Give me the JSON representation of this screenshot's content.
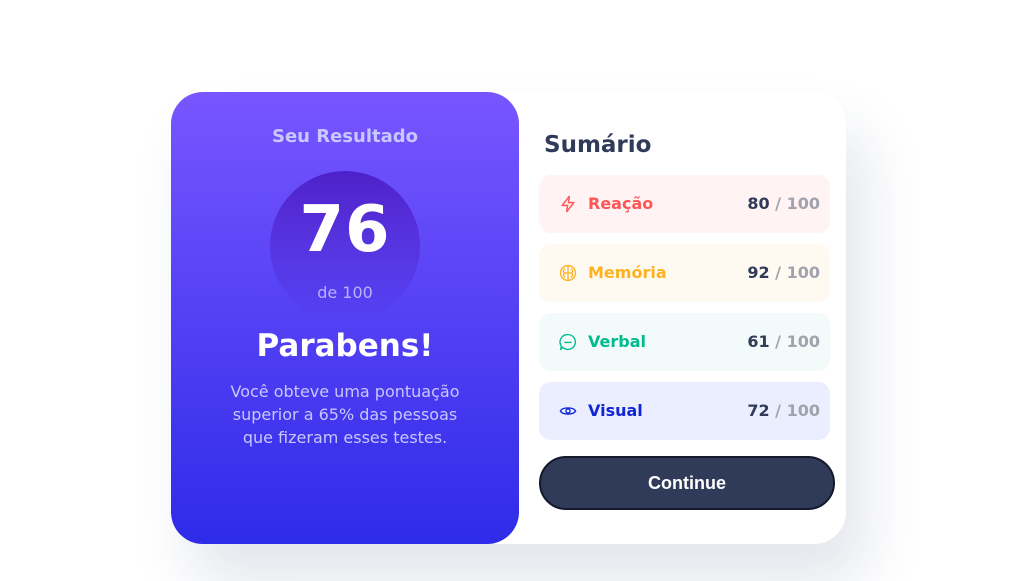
{
  "result": {
    "heading": "Seu Resultado",
    "score": "76",
    "score_of": "de 100",
    "title": "Parabens!",
    "description": "Você obteve uma pontuação superior a 65% das pessoas que fizeram esses testes."
  },
  "summary": {
    "title": "Sumário",
    "items": [
      {
        "label": "Reação",
        "score": "80",
        "separator": " / ",
        "total": "100",
        "icon": "lightning-icon",
        "color": "#ff5555"
      },
      {
        "label": "Memória",
        "score": "92",
        "separator": " / ",
        "total": "100",
        "icon": "brain-icon",
        "color": "#ffb11f"
      },
      {
        "label": "Verbal",
        "score": "61",
        "separator": " / ",
        "total": "100",
        "icon": "chat-bubble-icon",
        "color": "#00bb8f"
      },
      {
        "label": "Visual",
        "score": "72",
        "separator": " / ",
        "total": "100",
        "icon": "eye-icon",
        "color": "#1125d6"
      }
    ],
    "continue_label": "Continue"
  },
  "colors": {
    "gradient_top": "#7856ff",
    "gradient_bottom": "#2e2be9",
    "button": "#303b5a"
  }
}
